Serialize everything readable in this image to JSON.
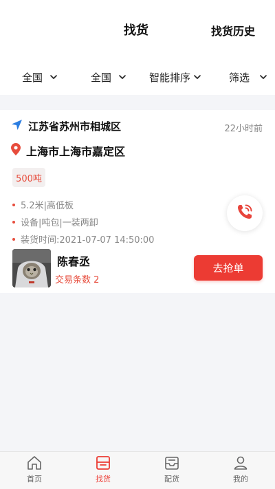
{
  "header": {
    "title": "找货",
    "history_label": "找货历史"
  },
  "filters": [
    {
      "label": "全国"
    },
    {
      "label": "全国"
    },
    {
      "label": "智能排序"
    },
    {
      "label": "筛选"
    }
  ],
  "order": {
    "from_address": "江苏省苏州市相城区",
    "to_address": "上海市上海市嘉定区",
    "time_ago": "22小时前",
    "weight": "500吨",
    "details": [
      "5.2米|高低板",
      "设备|吨包|一装两卸",
      "装货时间:2021-07-07 14:50:00"
    ],
    "user_name": "陈春丞",
    "trade_count": "交易条数 2",
    "grab_label": "去抢单"
  },
  "tabs": [
    {
      "label": "首页"
    },
    {
      "label": "找货"
    },
    {
      "label": "配货"
    },
    {
      "label": "我的"
    }
  ],
  "colors": {
    "accent": "#ec3b33",
    "nav_arrow": "#2a7de1",
    "background": "#f4f5f8"
  },
  "icons": {
    "from": "navigation-arrow-icon",
    "to": "location-pin-icon",
    "call": "phone-call-icon"
  }
}
